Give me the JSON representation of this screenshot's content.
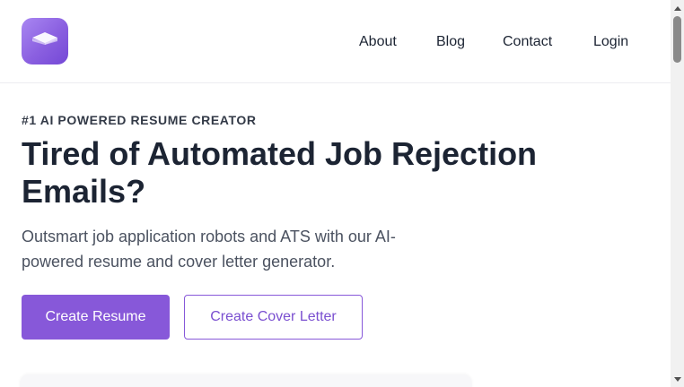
{
  "brand": {
    "logo_icon": "stacked-layers-icon",
    "logo_gradient": [
      "#a987f2",
      "#7448d6"
    ]
  },
  "nav": {
    "about": "About",
    "blog": "Blog",
    "contact": "Contact",
    "login": "Login"
  },
  "hero": {
    "eyebrow": "#1 AI POWERED RESUME CREATOR",
    "headline": "Tired of Automated Job Rejection Emails?",
    "subtext": "Outsmart job application robots and ATS with our AI-powered resume and cover letter generator.",
    "primary_cta": "Create Resume",
    "secondary_cta": "Create Cover Letter"
  },
  "colors": {
    "accent": "#8758d9",
    "text_dark": "#1c2433",
    "text_body": "#4b5260"
  }
}
